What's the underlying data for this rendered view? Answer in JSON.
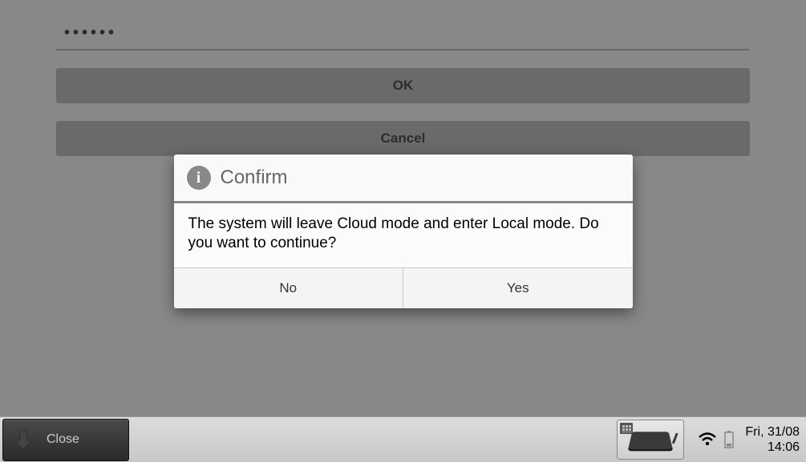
{
  "form": {
    "password_value": "••••••",
    "ok_label": "OK",
    "cancel_label": "Cancel"
  },
  "modal": {
    "title": "Confirm",
    "message": "The system will leave Cloud mode and enter Local mode. Do you want to continue?",
    "no_label": "No",
    "yes_label": "Yes"
  },
  "taskbar": {
    "close_label": "Close",
    "date": "Fri, 31/08",
    "time": "14:06"
  }
}
